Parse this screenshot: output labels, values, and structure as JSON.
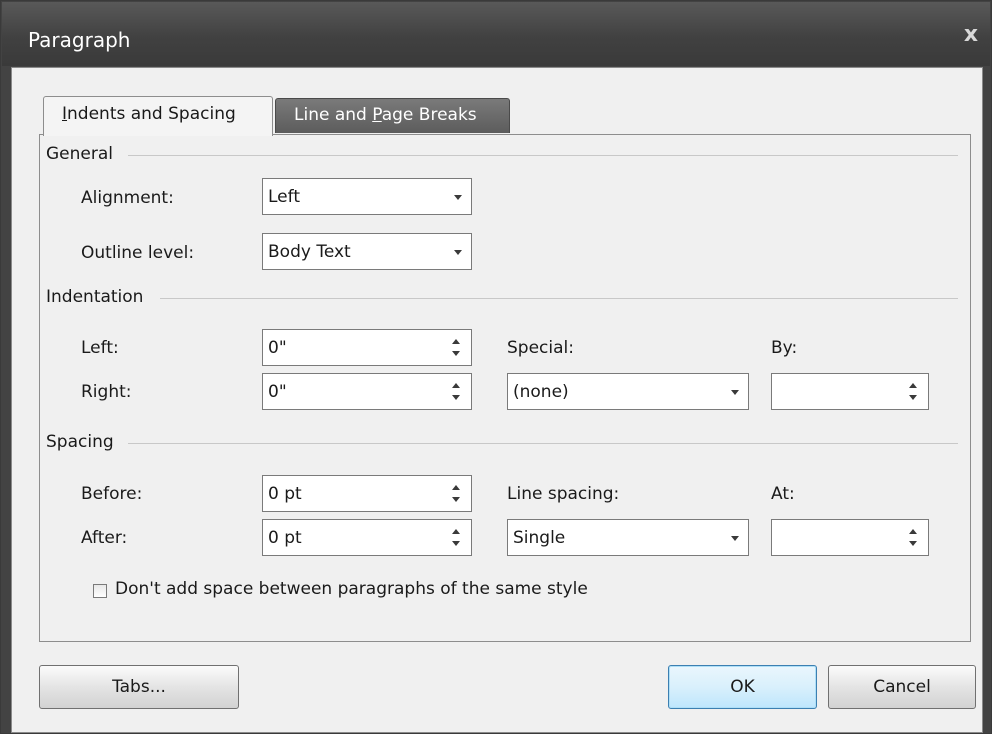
{
  "window": {
    "title": "Paragraph",
    "close_glyph": "x"
  },
  "tabs": [
    {
      "label_pre": "",
      "label_key": "I",
      "label_post": "ndents and Spacing"
    },
    {
      "label_pre": "Line and ",
      "label_key": "P",
      "label_post": "age Breaks"
    }
  ],
  "general": {
    "heading": "General",
    "alignment_label": "Alignment:",
    "alignment_value": "Left",
    "outline_label": "Outline level:",
    "outline_value": "Body Text"
  },
  "indentation": {
    "heading": "Indentation",
    "left_label": "Left:",
    "left_value": "0\"",
    "right_label": "Right:",
    "right_value": "0\"",
    "special_label": "Special:",
    "special_value": "(none)",
    "by_label": "By:",
    "by_value": ""
  },
  "spacing": {
    "heading": "Spacing",
    "before_label": "Before:",
    "before_value": "0 pt",
    "after_label": "After:",
    "after_value": "0 pt",
    "line_spacing_label": "Line spacing:",
    "line_spacing_value": "Single",
    "at_label": "At:",
    "at_value": "",
    "dont_add_space_label": "Don't add space between paragraphs of the same style",
    "dont_add_space_checked": false
  },
  "buttons": {
    "tabs": "Tabs...",
    "ok": "OK",
    "cancel": "Cancel"
  }
}
